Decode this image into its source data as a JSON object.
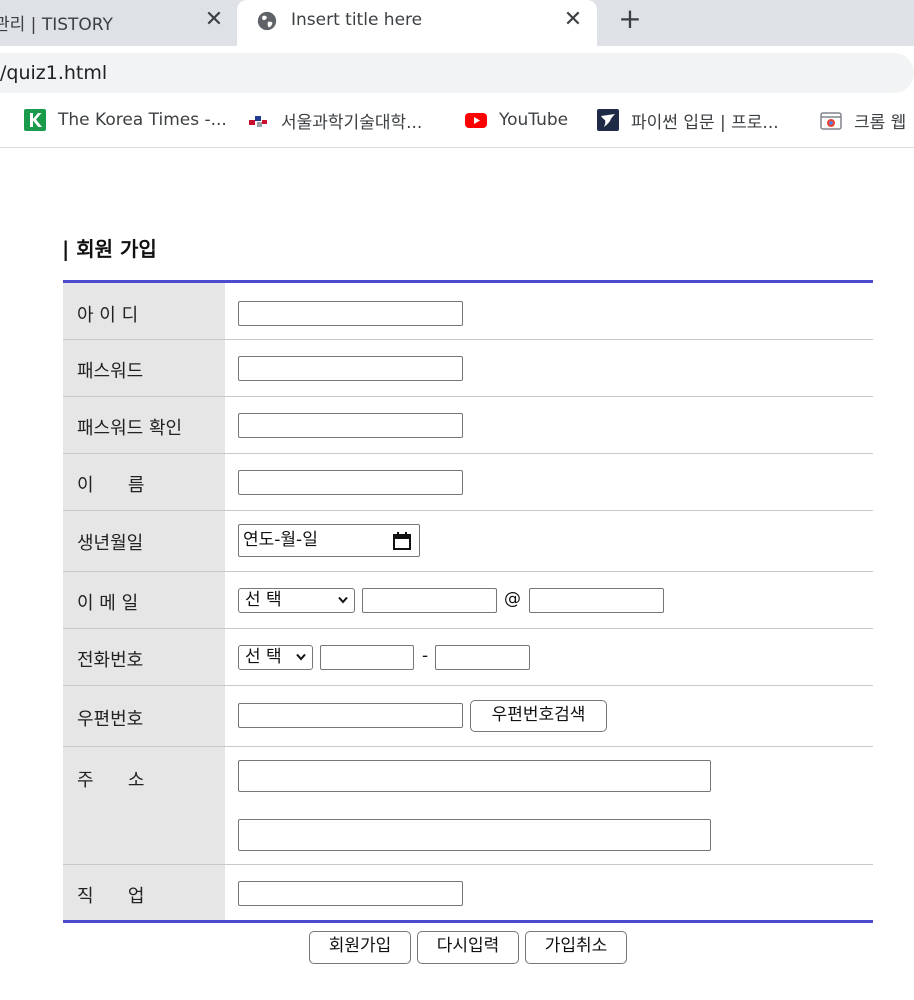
{
  "browser": {
    "tabs": [
      {
        "title": "관리 | TISTORY",
        "active": false
      },
      {
        "title": "Insert title here",
        "active": true
      }
    ],
    "close_glyph": "✕",
    "new_tab_glyph": "+",
    "url": "/quiz1.html",
    "bookmarks": [
      {
        "label": "The Korea Times -...",
        "icon": "korea-times-icon"
      },
      {
        "label": "서울과학기술대학...",
        "icon": "seoultech-icon"
      },
      {
        "label": "YouTube",
        "icon": "youtube-icon"
      },
      {
        "label": "파이썬 입문 | 프로...",
        "icon": "python-course-icon"
      },
      {
        "label": "크롬 웹",
        "icon": "chrome-webstore-icon"
      }
    ]
  },
  "page": {
    "title": "| 회원 가입",
    "accent_color": "#4b4bcf"
  },
  "form": {
    "id_label": "아 이 디",
    "password_label": "패스워드",
    "password_confirm_label": "패스워드 확인",
    "name_label": "이      름",
    "birth_label": "생년월일",
    "birth_placeholder": "연도-월-일",
    "email_label": "이 메 일",
    "email_domain_select": "선 택",
    "email_at": "@",
    "phone_label": "전화번호",
    "phone_prefix_select": "선 택",
    "phone_dash": "-",
    "zip_label": "우편번호",
    "zip_search_button": "우편번호검색",
    "address_label": "주      소",
    "job_label": "직      업"
  },
  "actions": {
    "submit": "회원가입",
    "reset": "다시입력",
    "cancel": "가입취소"
  }
}
